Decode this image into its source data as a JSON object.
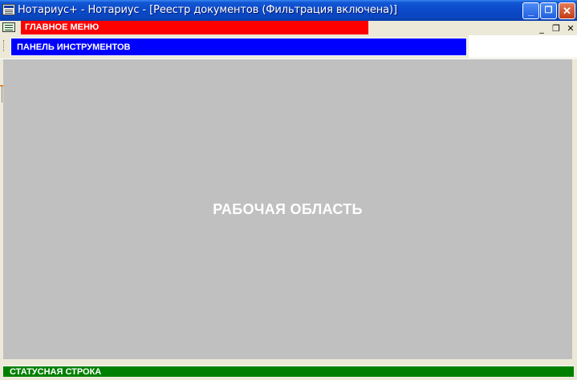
{
  "window": {
    "title": "Нотариус+ - Нотариус - [Реестр документов (Фильтрация включена)]",
    "controls": {
      "minimize": "_",
      "maximize": "❐",
      "close": "✕"
    }
  },
  "menu": {
    "label": "ГЛАВНОЕ МЕНЮ",
    "color": "#ff0000",
    "mdi_controls": {
      "minimize": "_",
      "restore": "❐",
      "close": "✕"
    }
  },
  "toolbar": {
    "label": "ПАНЕЛЬ ИНСТРУМЕНТОВ",
    "color": "#0000ff"
  },
  "workspace": {
    "label": "РАБОЧАЯ ОБЛАСТЬ",
    "color": "#c0c0c0"
  },
  "statusbar": {
    "label": "СТАТУСНАЯ СТРОКА",
    "color": "#008000"
  },
  "icons": [
    "app-icon",
    "document-icon",
    "minimize-icon",
    "maximize-icon",
    "close-icon"
  ]
}
